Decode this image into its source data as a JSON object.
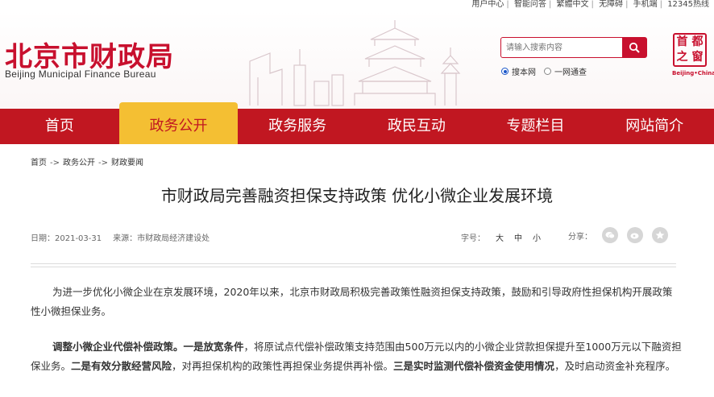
{
  "util_bar": {
    "items": [
      "用户中心",
      "智能问答",
      "繁體中文",
      "无障碍",
      "手机端",
      "12345热线"
    ]
  },
  "header": {
    "logo_cn": "北京市财政局",
    "logo_en": "Beijing Municipal Finance Bureau",
    "seal": [
      "首",
      "都",
      "之",
      "窗"
    ],
    "seal_caption": "Beijing•China"
  },
  "search": {
    "placeholder": "请输入搜索内容",
    "scope_options": [
      "搜本网",
      "一网通查"
    ],
    "scope_selected": "搜本网"
  },
  "nav": {
    "items": [
      "首页",
      "政务公开",
      "政务服务",
      "政民互动",
      "专题栏目",
      "网站简介"
    ],
    "active": "政务公开"
  },
  "breadcrumb": [
    "首页",
    "政务公开",
    "财政要闻"
  ],
  "article": {
    "title": "市财政局完善融资担保支持政策 优化小微企业发展环境",
    "date": "日期：2021-03-31",
    "source": "来源：市财政局经济建设处",
    "font_label": "字号：",
    "font_options": [
      "大",
      "中",
      "小"
    ],
    "share_label": "分享：",
    "p1": "为进一步优化小微企业在京发展环境，2020年以来，北京市财政局积极完善政策性融资担保支持政策，鼓励和引导政府性担保机构开展政策性小微担保业务。",
    "p2_seg1": "调整小微企业代偿补偿政策。",
    "p2_seg2": "一是放宽条件",
    "p2_seg3": "，将原试点代偿补偿政策支持范围由500万元以内的小微企业贷款担保提升至1000万元以下融资担保业务。",
    "p2_seg4": "二是有效分散经营风险",
    "p2_seg5": "，对再担保机构的政策性再担保业务提供再补偿。",
    "p2_seg6": "三是实时监测代偿补偿资金使用情况",
    "p2_seg7": "，及时启动资金补充程序。"
  },
  "colors": {
    "brand_red": "#c11721",
    "active_tab": "#f4bf33"
  }
}
